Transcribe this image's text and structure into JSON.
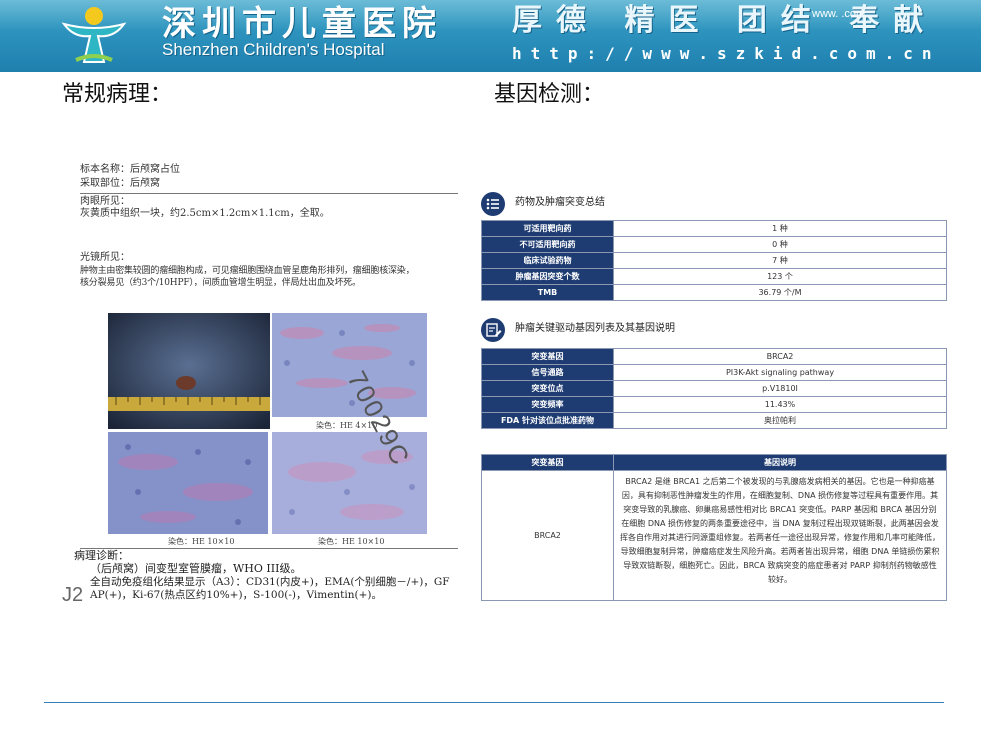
{
  "header": {
    "hospital_cn": "深圳市儿童医院",
    "hospital_en": "Shenzhen Children's Hospital",
    "motto": "厚德 精医 团结 奉献",
    "watermark_url": "www.   .com",
    "site_url": "http://www.szkid.com.cn",
    "colors": {
      "banner": "#2a8fbb",
      "accent": "#1e3c72"
    }
  },
  "sections": {
    "left_title": "常规病理：",
    "right_title": "基因检测："
  },
  "pathology": {
    "specimen_name": "标本名称：后颅窝占位",
    "sampling_site": "采取部位：后颅窝",
    "gross_label": "肉眼所见：",
    "gross_text": "灰黄质中组织一块，约2.5cm×1.2cm×1.1cm，全取。",
    "micro_label": "光镜所见：",
    "micro_text_1": "肿物主由密集较圆的瘤细胞构成，可见瘤细胞围绕血管呈鹿角形排列，瘤细胞核深染，",
    "micro_text_2": "核分裂易见（约3个/10HPF），间质血管增生明显，伴局灶出血及坏死。",
    "captions": [
      "染色：HE 4×10",
      "染色：HE 10×10",
      "染色：HE 10×10"
    ],
    "stamp": "70029C",
    "diagnosis_label": "病理诊断：",
    "diagnosis_1": "（后颅窝）间变型室管膜瘤，WHO III级。",
    "diagnosis_2": "全自动免疫组化结果显示（A3）：CD31(内皮+)，EMA(个别细胞－/+)，GF",
    "diagnosis_3": "AP(+)，Ki-67(热点区约10%+)，S-100(-)，Vimentin(+)。",
    "hand_mark": "J2"
  },
  "gene": {
    "summary_title": "药物及肿瘤突变总结",
    "summary_rows": [
      {
        "label": "可适用靶向药",
        "value": "1 种"
      },
      {
        "label": "不可适用靶向药",
        "value": "0 种"
      },
      {
        "label": "临床试验药物",
        "value": "7 种"
      },
      {
        "label": "肿瘤基因突变个数",
        "value": "123 个"
      },
      {
        "label": "TMB",
        "value": "36.79 个/M"
      }
    ],
    "driver_title": "肿瘤关键驱动基因列表及其基因说明",
    "driver_rows": [
      {
        "label": "突变基因",
        "value": "BRCA2"
      },
      {
        "label": "信号通路",
        "value": "PI3K-Akt signaling pathway"
      },
      {
        "label": "突变位点",
        "value": "p.V1810I"
      },
      {
        "label": "突变频率",
        "value": "11.43%"
      },
      {
        "label": "FDA 针对该位点批准药物",
        "value": "奥拉帕利"
      }
    ],
    "desc_headers": [
      "突变基因",
      "基因说明"
    ],
    "desc_gene": "BRCA2",
    "desc_text": "BRCA2 是继 BRCA1 之后第二个被发现的与乳腺癌发病相关的基因。它也是一种抑癌基因，具有抑制恶性肿瘤发生的作用，在细胞复制、DNA 损伤修复等过程具有重要作用。其突变导致的乳腺癌、卵巢癌易感性相对比 BRCA1 突变低。PARP 基因和 BRCA 基因分别在细胞 DNA 损伤修复的两条重要途径中，当 DNA 复制过程出现双链断裂，此两基因会发挥各自作用对其进行同源重组修复。若两者任一途径出现异常，修复作用和几率可能降低，导致细胞复制异常，肿瘤癌症发生风险升高。若两者皆出现异常，细胞 DNA 单链损伤累积导致双链断裂，细胞死亡。因此，BRCA 致病突变的癌症患者对 PARP 抑制剂药物敏感性较好。"
  }
}
